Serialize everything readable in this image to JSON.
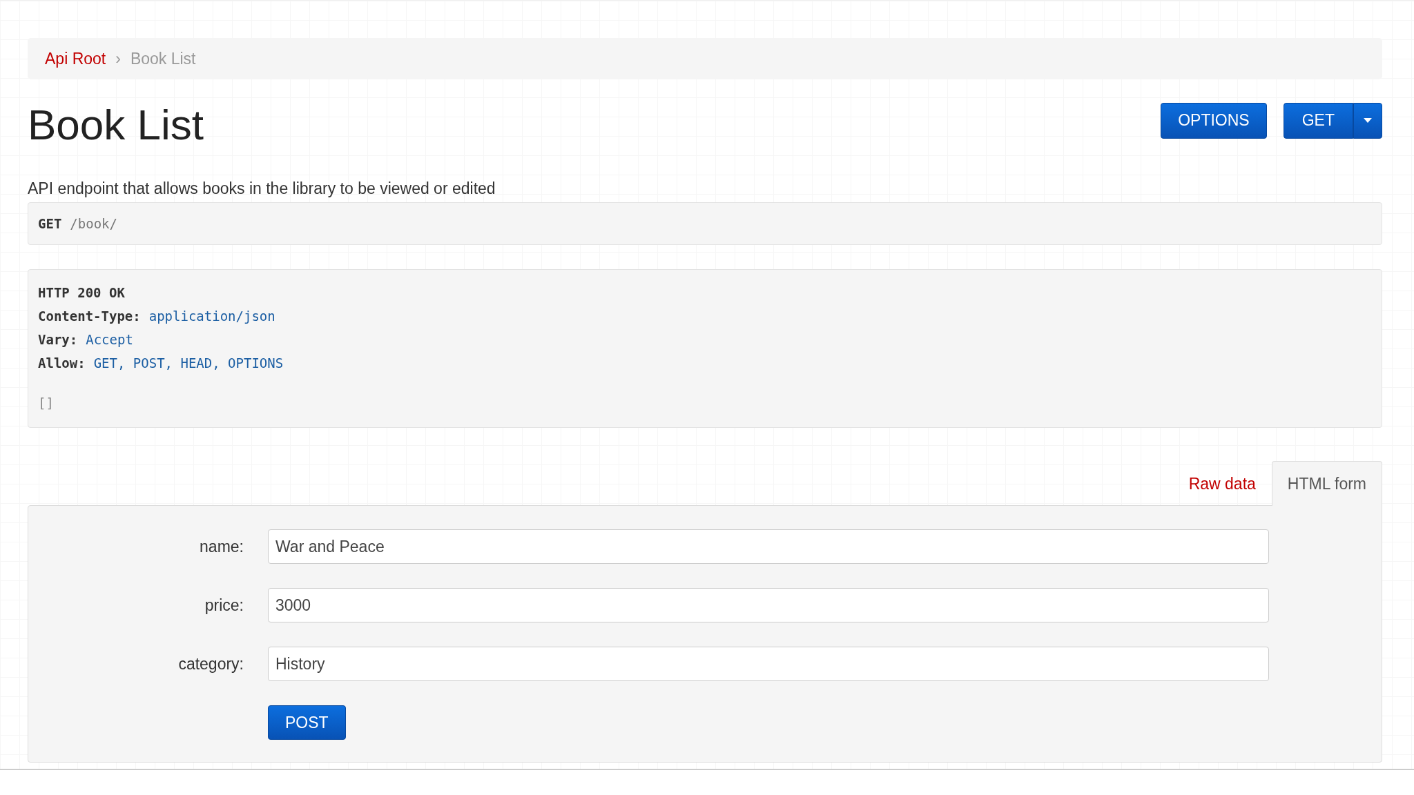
{
  "breadcrumb": {
    "separator": "›",
    "items": [
      {
        "label": "Api Root",
        "selected": false
      },
      {
        "label": "Book List",
        "selected": true
      }
    ]
  },
  "title": "Book List",
  "buttons": {
    "options": "OPTIONS",
    "get": "GET"
  },
  "description": "API endpoint that allows books in the library to be viewed or edited",
  "request": {
    "method": "GET",
    "path": "/book/"
  },
  "response": {
    "status": "HTTP 200 OK",
    "headers": [
      {
        "name": "Content-Type:",
        "value": "application/json"
      },
      {
        "name": "Vary:",
        "value": "Accept"
      },
      {
        "name": "Allow:",
        "value": "GET, POST, HEAD, OPTIONS"
      }
    ],
    "body": "[]"
  },
  "tabs": [
    {
      "label": "Raw data",
      "selected": false
    },
    {
      "label": "HTML form",
      "selected": true
    }
  ],
  "form": {
    "fields": [
      {
        "label": "name:",
        "value": "War and Peace"
      },
      {
        "label": "price:",
        "value": "3000"
      },
      {
        "label": "category:",
        "value": "History"
      }
    ],
    "submit": "POST"
  }
}
